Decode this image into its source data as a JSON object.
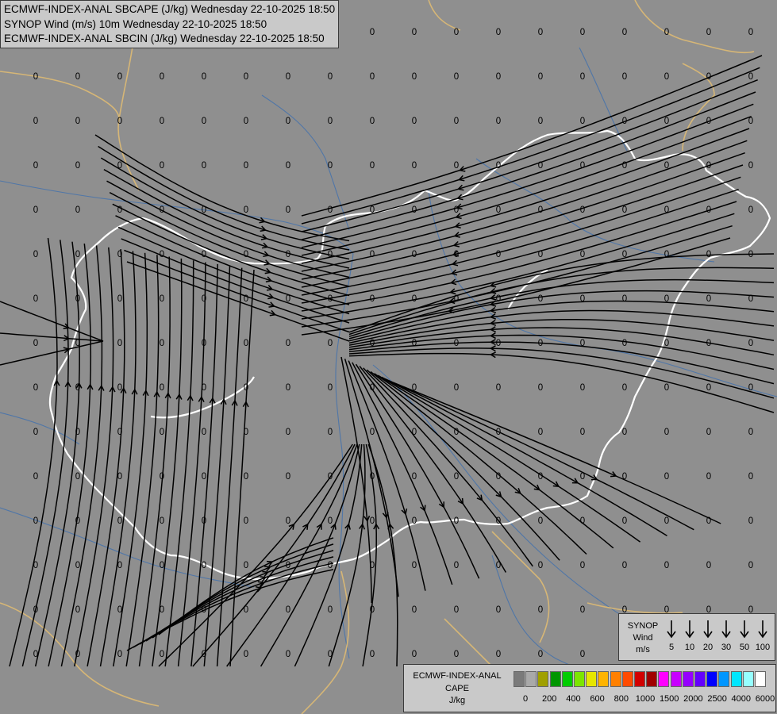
{
  "header": {
    "line1": "ECMWF-INDEX-ANAL SBCAPE (J/kg) Wednesday 22-10-2025 18:50",
    "line2": "SYNOP Wind (m/s) 10m Wednesday 22-10-2025 18:50",
    "line3": "ECMWF-INDEX-ANAL SBCIN (J/kg) Wednesday 22-10-2025 18:50"
  },
  "map": {
    "background_color": "#8f8f8f",
    "border_color": "#ffffff",
    "outer_border_color": "#d6b676",
    "river_color": "#4f76a8",
    "streamline_color": "#000000",
    "grid_value": "0"
  },
  "synop_legend": {
    "title_line1": "SYNOP",
    "title_line2": "Wind",
    "title_line3": "m/s",
    "values": [
      "5",
      "10",
      "20",
      "30",
      "50",
      "100"
    ]
  },
  "cape_legend": {
    "title_line1": "ECMWF-INDEX-ANAL",
    "title_line2": "CAPE",
    "title_line3": "J/kg",
    "colors": [
      "#7a7a7a",
      "#a9a9a9",
      "#a0a000",
      "#009600",
      "#00cd00",
      "#7ce600",
      "#e6e600",
      "#ffb400",
      "#ff8000",
      "#ff4b00",
      "#d20000",
      "#a00000",
      "#ff00ff",
      "#c800ff",
      "#9600ff",
      "#6400ff",
      "#0000ff",
      "#0096ff",
      "#00e6ff",
      "#96ffff",
      "#ffffff"
    ],
    "ticks": [
      "0",
      "200",
      "400",
      "600",
      "800",
      "1000",
      "1500",
      "2000",
      "2500",
      "4000",
      "6000"
    ]
  }
}
